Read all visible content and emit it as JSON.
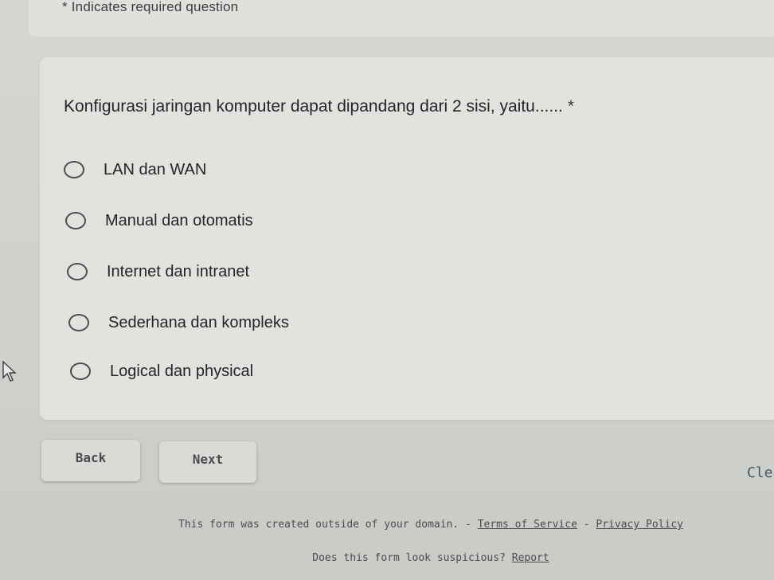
{
  "header": {
    "required_note": "* Indicates required question"
  },
  "question": {
    "title": "Konfigurasi jaringan komputer dapat dipandang dari 2 sisi, yaitu......",
    "required_marker": "*",
    "options": [
      {
        "label": "LAN dan WAN"
      },
      {
        "label": "Manual dan otomatis"
      },
      {
        "label": "Internet dan intranet"
      },
      {
        "label": "Sederhana dan kompleks"
      },
      {
        "label": "Logical dan physical"
      }
    ]
  },
  "navigation": {
    "back_label": "Back",
    "next_label": "Next",
    "clear_label": "Cle"
  },
  "footer": {
    "domain_note": "This form was created outside of your domain.",
    "separator": " - ",
    "terms_label": "Terms of Service",
    "separator2": " - ",
    "privacy_label": "Privacy Policy",
    "suspicious_prompt": "Does this form look suspicious?",
    "report_label": "Report"
  },
  "icons": {
    "cursor": "mouse-pointer-icon"
  }
}
